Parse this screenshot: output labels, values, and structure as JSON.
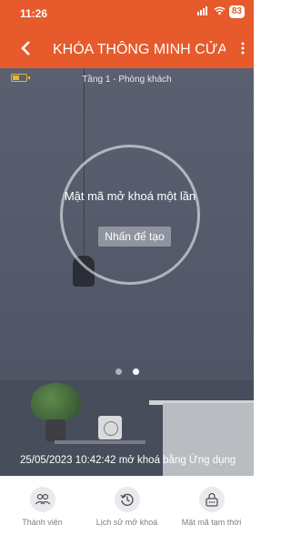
{
  "status_bar": {
    "time": "11:26",
    "signal": "::ll",
    "wifi": "wifi",
    "battery": "83"
  },
  "header": {
    "title": "KHÓA THÔNG MINH CỬA ...",
    "back_icon": "back-icon",
    "more_icon": "more-icon"
  },
  "lock": {
    "battery_level": 0.5,
    "room": "Tầng 1 - Phòng khách",
    "otp_title": "Mật mã mở khoá một lần",
    "create_button": "Nhấn để tạo",
    "page_index": 1,
    "page_count": 2,
    "last_event": "25/05/2023 10:42:42 mở khoá bằng Ứng dụng"
  },
  "bottom_nav": [
    {
      "label": "Thành viên",
      "icon": "members-icon"
    },
    {
      "label": "Lịch sử mở khoá",
      "icon": "history-icon"
    },
    {
      "label": "Mật mã tạm thời",
      "icon": "temp-password-icon"
    }
  ],
  "colors": {
    "header": "#e65a2c",
    "scene": "#555b6b",
    "battery_warning": "#e8b53a",
    "nav_icon_bg": "#e9eaee"
  }
}
